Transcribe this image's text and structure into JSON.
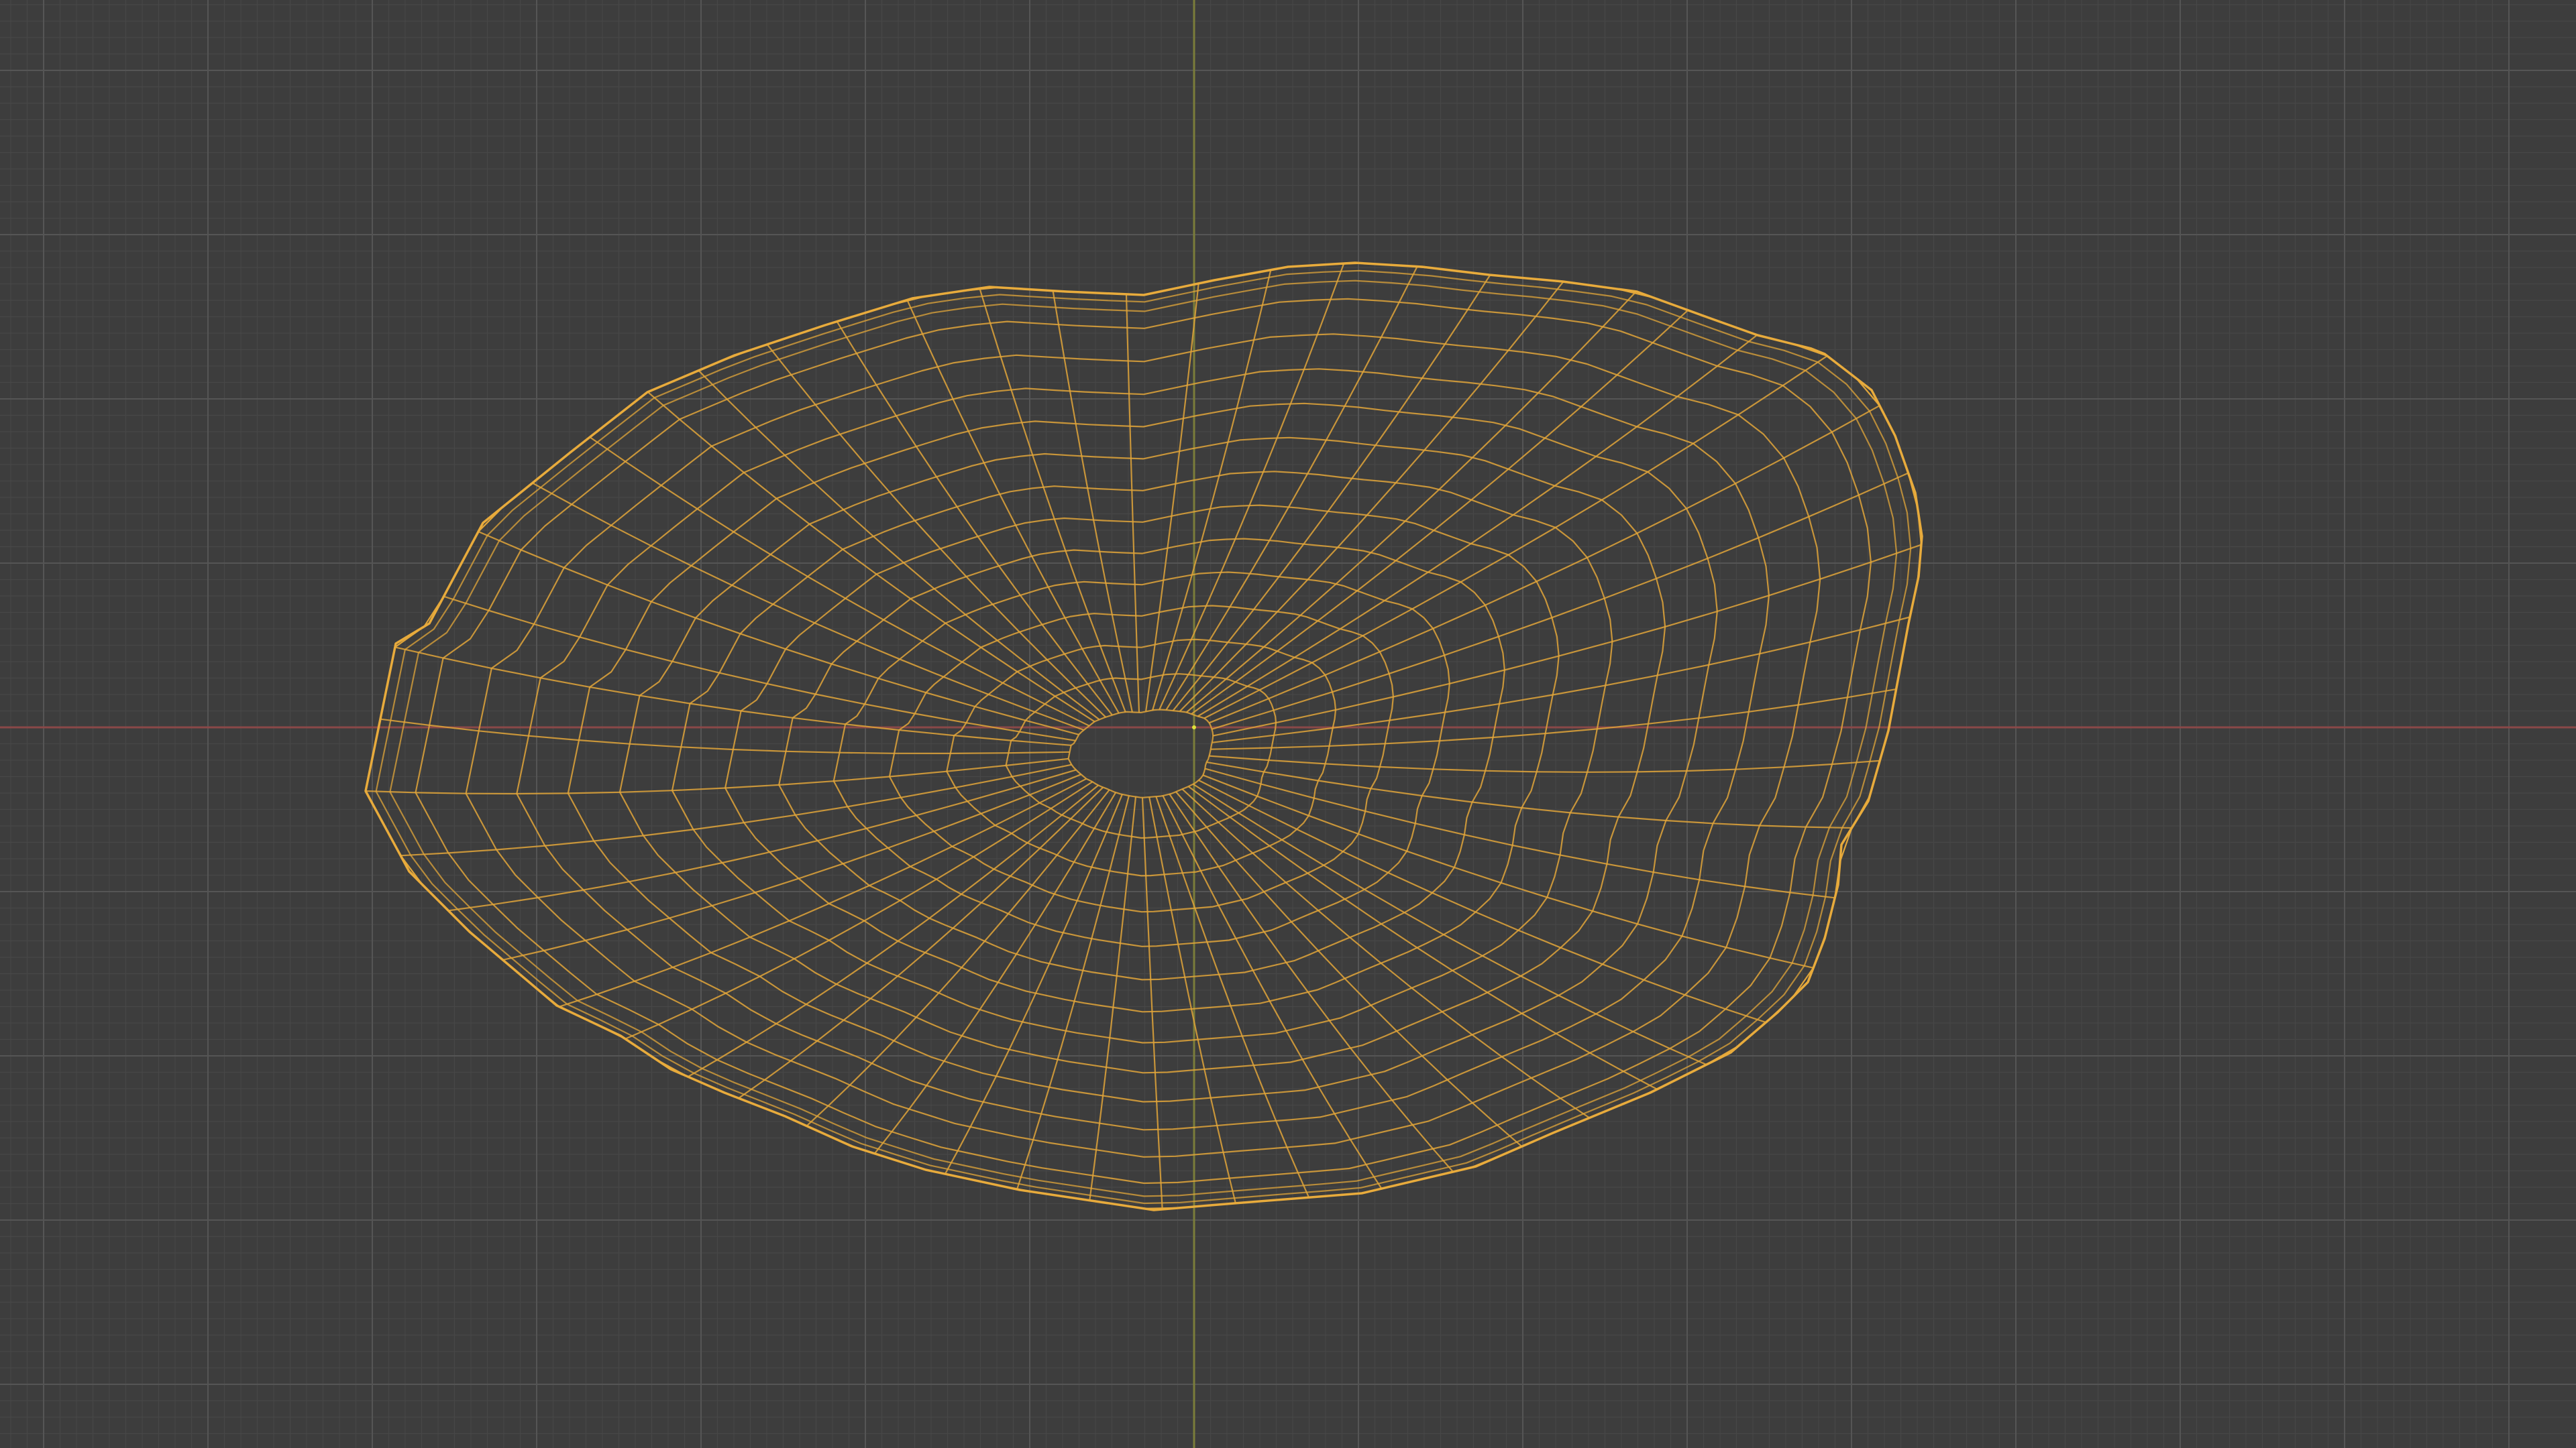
{
  "viewport": {
    "view": "3d-viewport-wireframe",
    "background_color": "#3d3d3d",
    "minor_grid_color": "#474747",
    "major_grid_color": "#555555",
    "x_axis_color": "#8a4848",
    "y_axis_color": "#7a7d3a",
    "wire_color": "#e0a53a",
    "origin_color": "#dfe23a"
  },
  "object": {
    "name_shown": "",
    "selected": true,
    "display": "wireframe"
  }
}
